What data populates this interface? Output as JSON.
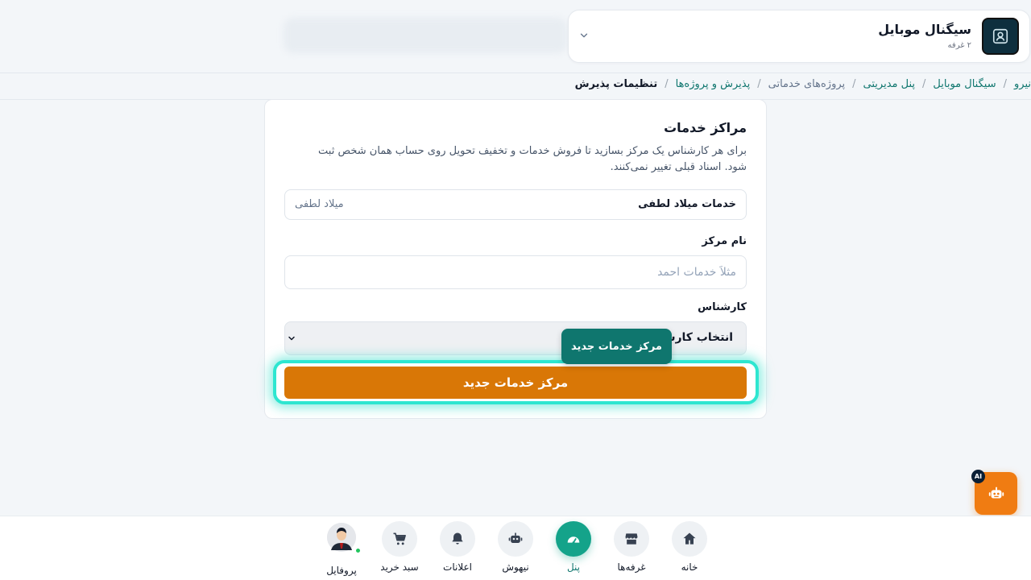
{
  "shop": {
    "name": "سیگنال موبایل",
    "subtitle": "۲ غرفه"
  },
  "breadcrumb": [
    {
      "label": "نیرو",
      "style": "link"
    },
    {
      "label": "سیگنال موبایل",
      "style": "link"
    },
    {
      "label": "پنل مدیریتی",
      "style": "link"
    },
    {
      "label": "پروژه‌های خدماتی",
      "style": "muted"
    },
    {
      "label": "پذیرش و پروژه‌ها",
      "style": "link"
    },
    {
      "label": "تنظیمات پذیرش",
      "style": "current"
    }
  ],
  "panel": {
    "title": "مراکز خدمات",
    "description": "برای هر کارشناس یک مرکز بسازید تا فروش خدمات و تخفیف تحویل روی حساب همان شخص ثبت شود. اسناد قبلی تغییر نمی‌کنند.",
    "existing_center": {
      "name": "خدمات میلاد لطفی",
      "owner": "میلاد لطفی"
    },
    "name_field": {
      "label": "نام مرکز",
      "value": "",
      "placeholder": "مثلاً خدمات احمد"
    },
    "expert_field": {
      "label": "کارشناس",
      "selected": "انتخاب کارشناس"
    },
    "submit_label": "مرکز خدمات جدید"
  },
  "tooltip": "مرکز خدمات جدید",
  "ai_badge": "AI",
  "bottom_nav": {
    "home": "خانه",
    "booths": "غرفه‌ها",
    "panel": "پنل",
    "ai": "نیهوش",
    "notifications": "اعلانات",
    "cart": "سبد خرید",
    "profile": "پروفایل",
    "active": "panel"
  },
  "colors": {
    "accent": "#14a38a",
    "brand_link": "#0f766e",
    "cta": "#d97706",
    "cta_highlight": "#2ee6d0",
    "ai_fab": "#f07c12"
  },
  "icons": {
    "shop_logo": "contact-card-icon",
    "shop_switcher": "chevron-down-icon",
    "home": "home-icon",
    "booths": "store-icon",
    "panel": "dashboard-gauge-icon",
    "ai": "robot-icon",
    "notifications": "bell-icon",
    "cart": "cart-icon",
    "ai_fab": "robot-icon"
  }
}
